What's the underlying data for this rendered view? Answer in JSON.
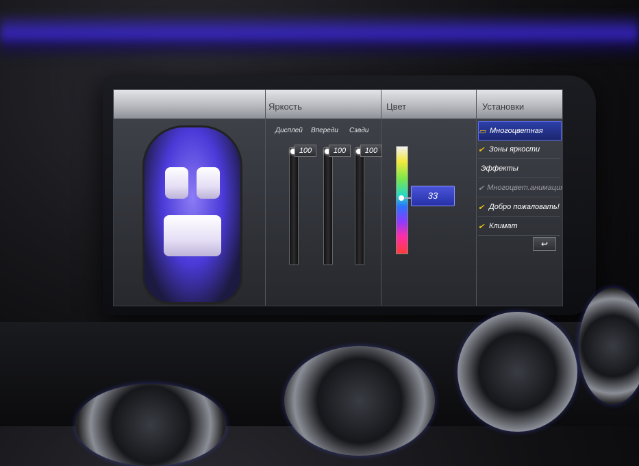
{
  "sections": {
    "brightness": "Яркость",
    "color": "Цвет",
    "settings": "Установки"
  },
  "sliders": [
    {
      "label": "Дисплей",
      "value": "100",
      "level_percent": 100
    },
    {
      "label": "Впереди",
      "value": "100",
      "level_percent": 100
    },
    {
      "label": "Сзади",
      "value": "100",
      "level_percent": 100
    }
  ],
  "color": {
    "value": "33",
    "knob_level_percent": 50
  },
  "menu": [
    {
      "label": "Многоцветная",
      "state": "selected"
    },
    {
      "label": "Зоны яркости",
      "state": "checked"
    },
    {
      "label": "Эффекты",
      "state": "header"
    },
    {
      "label": "Многоцвет.анимация",
      "state": "checked-disabled"
    },
    {
      "label": "Добро пожаловать!",
      "state": "checked"
    },
    {
      "label": "Климат",
      "state": "checked"
    }
  ],
  "back_icon": "back-arrow-icon",
  "colors": {
    "ambient": "#4b3ad8",
    "selected": "#2d3fa8",
    "check": "#f1c40f"
  }
}
